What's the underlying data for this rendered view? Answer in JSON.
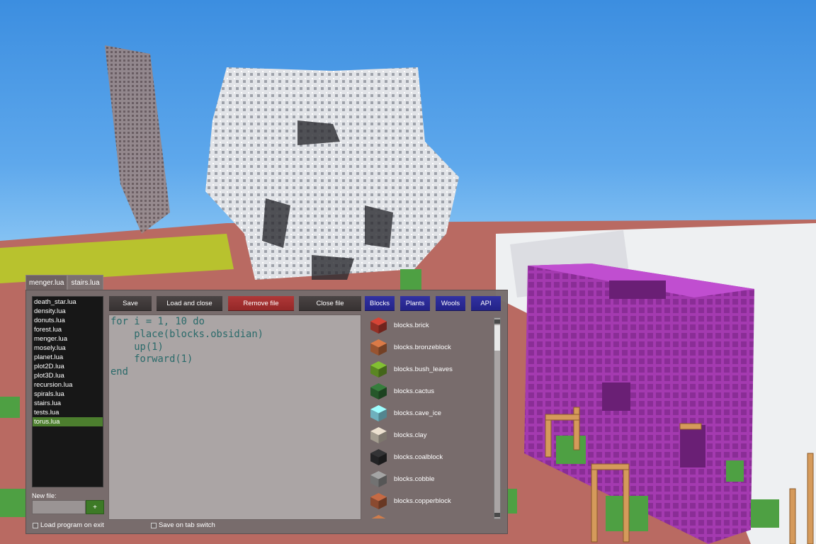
{
  "open_tabs": [
    "menger.lua",
    "stairs.lua"
  ],
  "files": [
    "death_star.lua",
    "density.lua",
    "donuts.lua",
    "forest.lua",
    "menger.lua",
    "mosely.lua",
    "planet.lua",
    "plot2D.lua",
    "plot3D.lua",
    "recursion.lua",
    "spirals.lua",
    "stairs.lua",
    "tests.lua",
    "torus.lua"
  ],
  "selected_file": "torus.lua",
  "new_file": {
    "label": "New file:",
    "value": "",
    "button": "+"
  },
  "options": {
    "load_on_exit": "Load program on exit",
    "save_on_tab_switch": "Save on tab switch"
  },
  "toolbar": {
    "save": "Save",
    "load_and_close": "Load and close",
    "remove_file": "Remove file",
    "close_file": "Close file",
    "blocks": "Blocks",
    "plants": "Plants",
    "wools": "Wools",
    "api": "API"
  },
  "code": "for i = 1, 10 do\n    place(blocks.obsidian)\n    up(1)\n    forward(1)\nend",
  "palette": [
    {
      "label": "blocks.brick",
      "icon": "brick-block-icon",
      "color": "#b53a2e"
    },
    {
      "label": "blocks.bronzeblock",
      "icon": "bronze-block-icon",
      "color": "#b9673c"
    },
    {
      "label": "blocks.bush_leaves",
      "icon": "bush-leaves-block-icon",
      "color": "#6ea32a"
    },
    {
      "label": "blocks.cactus",
      "icon": "cactus-block-icon",
      "color": "#2e6a33"
    },
    {
      "label": "blocks.cave_ice",
      "icon": "cave-ice-block-icon",
      "color": "#86d7e6"
    },
    {
      "label": "blocks.clay",
      "icon": "clay-block-icon",
      "color": "#c8bfb0"
    },
    {
      "label": "blocks.coalblock",
      "icon": "coal-block-icon",
      "color": "#2b2b2d"
    },
    {
      "label": "blocks.cobble",
      "icon": "cobble-block-icon",
      "color": "#8b8b8b"
    },
    {
      "label": "blocks.copperblock",
      "icon": "copper-block-icon",
      "color": "#a85a3a"
    },
    {
      "label": "",
      "icon": "partial-block-icon",
      "color": "#b06a40"
    }
  ]
}
